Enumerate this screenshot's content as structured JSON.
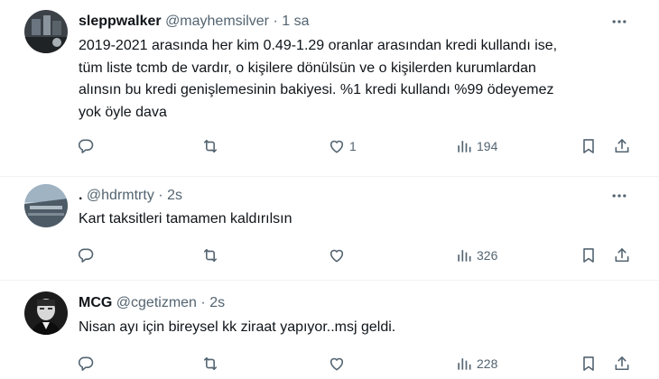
{
  "tweets": [
    {
      "name": "sleppwalker",
      "handle": "@mayhemsilver",
      "dot": "·",
      "time": "1 sa",
      "lines": [
        "2019-2021 arasında her kim 0.49-1.29 oranlar arasından kredi kullandı ise,",
        "tüm liste tcmb de vardır, o kişilere dönülsün ve o kişilerden kurumlardan",
        "alınsın bu kredi genişlemesinin bakiyesi. %1 kredi kullandı %99 ödeyemez",
        "yok öyle dava"
      ],
      "likes": "1",
      "views": "194",
      "avatar": "sleppwalker-avatar"
    },
    {
      "name": ".",
      "handle": "@hdrmtrty",
      "dot": "·",
      "time": "2s",
      "lines": [
        "Kart taksitleri tamamen kaldırılsın"
      ],
      "likes": "",
      "views": "326",
      "avatar": "hdrmtrty-avatar"
    },
    {
      "name": "MCG",
      "handle": "@cgetizmen",
      "dot": "·",
      "time": "2s",
      "lines": [
        "Nisan ayı için bireysel kk ziraat yapıyor..msj geldi."
      ],
      "likes": "",
      "views": "228",
      "avatar": "mcg-avatar"
    }
  ],
  "icons": {
    "reply": "reply-icon",
    "retweet": "retweet-icon",
    "like": "heart-icon",
    "views": "views-icon",
    "bookmark": "bookmark-icon",
    "share": "share-icon",
    "more": "more-icon"
  },
  "colors": {
    "text": "#0f1419",
    "muted": "#536471",
    "divider": "#eff3f4"
  }
}
